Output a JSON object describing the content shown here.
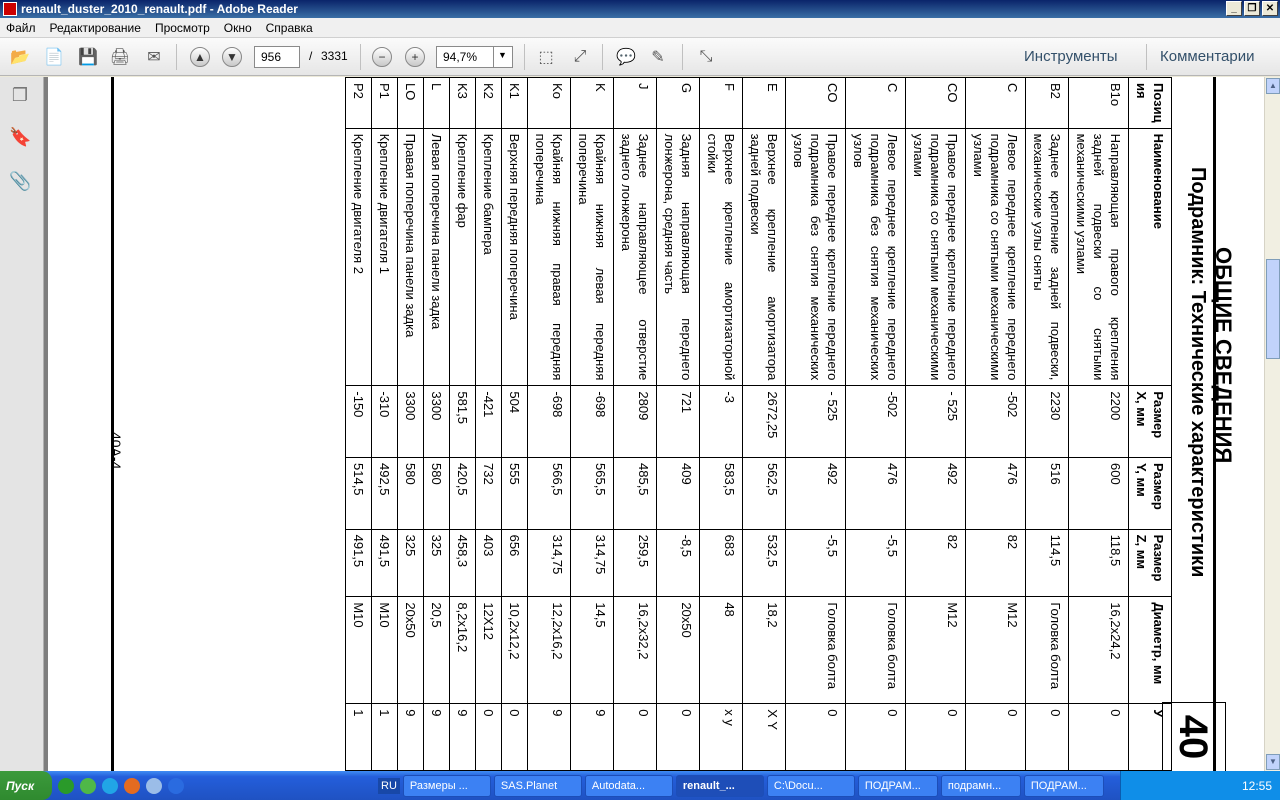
{
  "window": {
    "title": "renault_duster_2010_renault.pdf - Adobe Reader"
  },
  "menu": [
    "Файл",
    "Редактирование",
    "Просмотр",
    "Окно",
    "Справка"
  ],
  "toolbar": {
    "page_current": "956",
    "page_sep": "/",
    "page_total": "3331",
    "zoom": "94,7%",
    "tools_label": "Инструменты",
    "comments_label": "Комментарии"
  },
  "document": {
    "title": "ОБЩИЕ СВЕДЕНИЯ",
    "subtitle": "Подрамник: Технические характеристики",
    "section_badge": "40",
    "page_label": "40A-4",
    "table": {
      "headers": [
        "Позиц ия",
        "Наименование",
        "Размер X, мм",
        "Размер Y, мм",
        "Размер Z, мм",
        "Диаметр, мм",
        "У"
      ],
      "rows": [
        [
          "B1o",
          "Направляющая правого крепления задней подвески со снятыми механическими узлами",
          "2200",
          "600",
          "118,5",
          "16,2x24,2",
          "0"
        ],
        [
          "B2",
          "Заднее крепление задней подвески, механические узлы сняты",
          "2230",
          "516",
          "114,5",
          "Головка болта",
          "0"
        ],
        [
          "C",
          "Левое переднее крепление переднего подрамника со снятыми механическими узлами",
          "-502",
          "476",
          "82",
          "M12",
          "0"
        ],
        [
          "CO",
          "Правое переднее крепление переднего подрамника со снятыми механическими узлами",
          "- 525",
          "492",
          "82",
          "M12",
          "0"
        ],
        [
          "C",
          "Левое переднее крепление переднего подрамника без снятия механических узлов",
          "-502",
          "476",
          "-5,5",
          "Головка болта",
          "0"
        ],
        [
          "CO",
          "Правое переднее крепление переднего подрамника без снятия механических узлов",
          "- 525",
          "492",
          "-5,5",
          "Головка болта",
          "0"
        ],
        [
          "E",
          "Верхнее крепление амортизатора задней подвески",
          "2672,25",
          "562,5",
          "532,5",
          "18,2",
          "X Y"
        ],
        [
          "F",
          "Верхнее крепление амортизаторной стойки",
          "-3",
          "583,5",
          "683",
          "48",
          "x y"
        ],
        [
          "G",
          "Задняя направляющая переднего лонжерона, средняя часть",
          "721",
          "409",
          "-8,5",
          "20x50",
          "0"
        ],
        [
          "J",
          "Заднее направляющее отверстие заднего лонжерона",
          "2809",
          "485,5",
          "259,5",
          "16,2x32,2",
          "0"
        ],
        [
          "K",
          "Крайняя нижняя левая передняя поперечина",
          "-698",
          "565,5",
          "314,75",
          "14,5",
          "9"
        ],
        [
          "Ko",
          "Крайняя нижняя правая передняя поперечина",
          "-698",
          "566,5",
          "314,75",
          "12,2x16,2",
          "9"
        ],
        [
          "K1",
          "Верхняя передняя поперечина",
          "504",
          "555",
          "656",
          "10,2x12,2",
          "0"
        ],
        [
          "K2",
          "Крепление бампера",
          "-421",
          "732",
          "403",
          "12X12",
          "0"
        ],
        [
          "K3",
          "Крепление фар",
          "581,5",
          "420,5",
          "458,3",
          "8,2x16,2",
          "9"
        ],
        [
          "L",
          "Левая поперечина панели задка",
          "3300",
          "580",
          "325",
          "20,5",
          "9"
        ],
        [
          "LO",
          "Правая поперечина панели задка",
          "3300",
          "580",
          "325",
          "20x50",
          "9"
        ],
        [
          "P1",
          "Крепление двигателя 1",
          "-310",
          "492,5",
          "491,5",
          "M10",
          "1"
        ],
        [
          "P2",
          "Крепление двигателя 2",
          "-150",
          "514,5",
          "491,5",
          "M10",
          "1"
        ]
      ]
    }
  },
  "taskbar": {
    "start": "Пуск",
    "lang": "RU",
    "items": [
      "Размеры ...",
      "SAS.Planet",
      "Autodata...",
      "renault_...",
      "C:\\Docu...",
      "ПОДРАМ...",
      "подрамн...",
      "ПОДРАМ..."
    ],
    "clock": "12:55"
  }
}
